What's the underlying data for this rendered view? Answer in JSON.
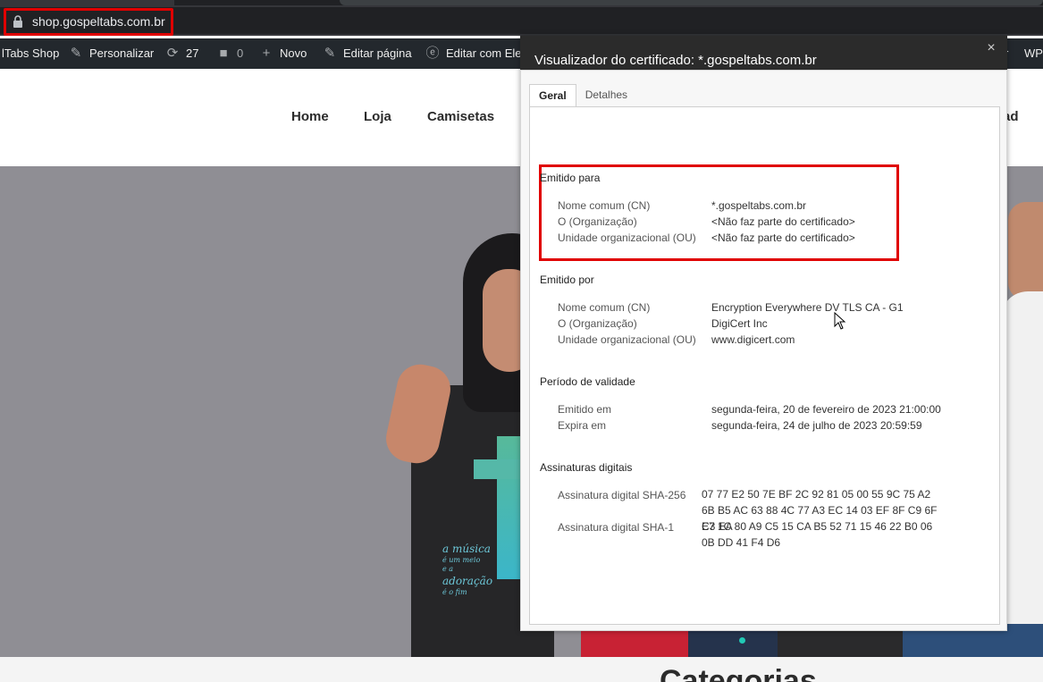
{
  "browser": {
    "url": "shop.gospeltabs.com.br"
  },
  "admin_bar": {
    "site_name": "lTabs Shop",
    "customize": "Personalizar",
    "updates_count": "27",
    "comments_count": "0",
    "new": "Novo",
    "edit_page": "Editar página",
    "edit_with": "Editar com Ele",
    "right_fragment_1": "r",
    "right_fragment_2": "WP"
  },
  "nav": {
    "items": [
      "Home",
      "Loja",
      "Camisetas"
    ],
    "right_fragment": "ad"
  },
  "hero": {
    "shirt_text_lines": [
      "a música",
      "é um meio",
      "e a",
      "adoração",
      "é o fim"
    ]
  },
  "page": {
    "section_heading": "Categorias"
  },
  "dialog": {
    "title": "Visualizador do certificado: *.gospeltabs.com.br",
    "close_label": "×",
    "tabs": [
      "Geral",
      "Detalhes"
    ],
    "sections": {
      "issued_to": {
        "title": "Emitido para",
        "rows": [
          {
            "label": "Nome comum (CN)",
            "value": "*.gospeltabs.com.br"
          },
          {
            "label": "O (Organização)",
            "value": "<Não faz parte do certificado>"
          },
          {
            "label": "Unidade organizacional (OU)",
            "value": "<Não faz parte do certificado>"
          }
        ]
      },
      "issued_by": {
        "title": "Emitido por",
        "rows": [
          {
            "label": "Nome comum (CN)",
            "value": "Encryption Everywhere DV TLS CA - G1"
          },
          {
            "label": "O (Organização)",
            "value": "DigiCert Inc"
          },
          {
            "label": "Unidade organizacional (OU)",
            "value": "www.digicert.com"
          }
        ]
      },
      "validity": {
        "title": "Período de validade",
        "rows": [
          {
            "label": "Emitido em",
            "value": "segunda-feira, 20 de fevereiro de 2023 21:00:00"
          },
          {
            "label": "Expira em",
            "value": "segunda-feira, 24 de julho de 2023 20:59:59"
          }
        ]
      },
      "fingerprints": {
        "title": "Assinaturas digitais",
        "rows": [
          {
            "label": "Assinatura digital SHA-256",
            "value": "07 77 E2 50 7E BF 2C 92 81 05 00 55 9C 75 A2 6B B5 AC 63 88 4C 77 A3 EC 14 03 EF 8F C9 6F C3 EA"
          },
          {
            "label": "Assinatura digital SHA-1",
            "value": "E7 1C 80 A9 C5 15 CA B5 52 71 15 46 22 B0 06 0B DD 41 F4 D6"
          }
        ]
      }
    }
  },
  "colors": {
    "highlight": "#e00000",
    "admin_bar_bg": "#23282d",
    "dialog_title_bg": "#2b2b2b"
  }
}
